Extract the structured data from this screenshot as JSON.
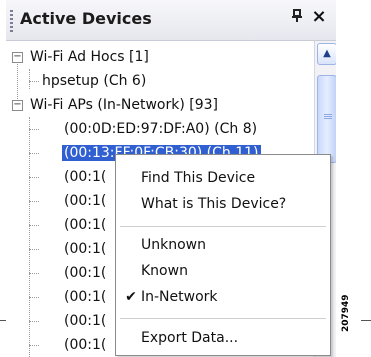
{
  "panel": {
    "title": "Active Devices",
    "pin_glyph": "p",
    "close_glyph": "×"
  },
  "tree": {
    "groups": [
      {
        "label": "Wi-Fi Ad Hocs [1]",
        "expanded": true,
        "children": [
          "hpsetup (Ch 6)"
        ]
      },
      {
        "label": "Wi-Fi APs (In-Network) [93]",
        "expanded": true,
        "children": [
          "(00:0D:ED:97:DF:A0) (Ch 8)",
          "(00:13:FF:0F:CB:30) (Ch 11)",
          "(00:1(",
          "(00:1(",
          "(00:1(",
          "(00:1(",
          "(00:1(",
          "(00:1(",
          "(00:1(",
          "(00:1("
        ],
        "selected_index": 1
      }
    ]
  },
  "context_menu": {
    "items": [
      {
        "label": "Find This Device"
      },
      {
        "label": "What is This Device?"
      },
      {
        "label": "Unknown"
      },
      {
        "label": "Known"
      },
      {
        "label": "In-Network",
        "checked": true
      },
      {
        "label": "Export Data..."
      }
    ]
  },
  "figure_id": "207949",
  "colors": {
    "selection": "#2f5fd0",
    "titlebar_top": "#f7f7fa",
    "titlebar_bottom": "#e6e7ee",
    "scrollbar_accent": "#9fb3e6"
  }
}
